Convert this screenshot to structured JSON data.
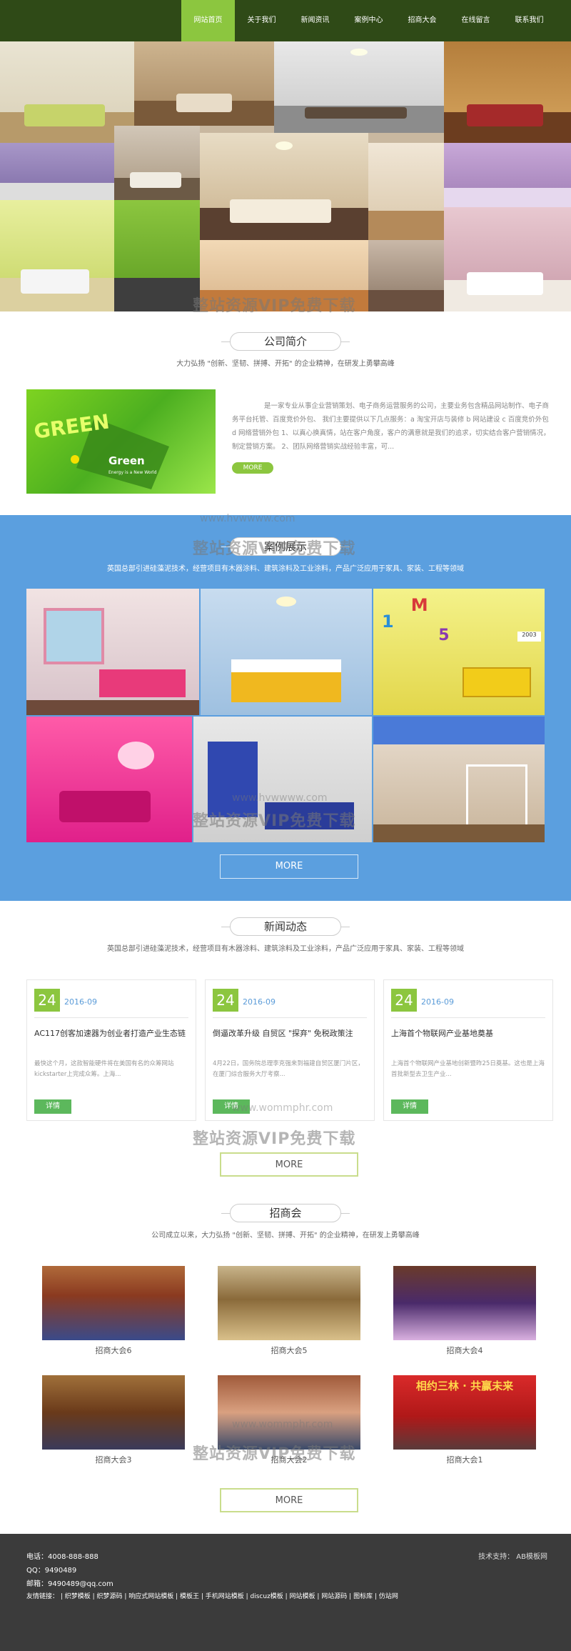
{
  "nav": {
    "items": [
      "网站首页",
      "关于我们",
      "新闻资讯",
      "案例中心",
      "招商大会",
      "在线留言",
      "联系我们"
    ]
  },
  "watermark": {
    "text": "整站资源VIP免费下载",
    "url1": "www.hvwwww.com",
    "url2": "www.wommphr.com"
  },
  "about": {
    "title": "公司简介",
    "subtitle": "大力弘扬 \"创新、坚韧、拼搏、开拓\" 的企业精神，在研发上勇攀高峰",
    "image_text_1": "GREEN",
    "image_text_2": "Green",
    "image_text_3": "Energy is a New World",
    "body": "是一家专业从事企业营销策划、电子商务运营服务的公司，主要业务包含精品网站制作、电子商务平台托管、百度竞价外包、 我们主要提供以下几点服务：a 淘宝开店与装修 b 网站建设 c 百度竞价外包 d 网络营销外包 1、以真心换真情，站在客户角度，客户的满意就是我们的追求，切实结合客户营销情况，制定营销方案。 2、团队网络营销实战经验丰富，可...",
    "more": "MORE"
  },
  "cases": {
    "title": "案例展示",
    "subtitle": "英国总部引进硅藻泥技术，经营项目有木器涂料、建筑涂料及工业涂料，产品广泛应用于家具、家装、工程等领域",
    "more": "MORE",
    "tile_text": "2003"
  },
  "news": {
    "title": "新闻动态",
    "subtitle": "英国总部引进硅藻泥技术，经营项目有木器涂料、建筑涂料及工业涂料，产品广泛应用于家具、家装、工程等领域",
    "more": "MORE",
    "items": [
      {
        "day": "24",
        "month": "2016-09",
        "title": "AC117创客加速器为创业者打造产业生态链",
        "desc": "最快这个月，这款智能硬件将在美国有名的众筹网站kickstarter上完成众筹。上海...",
        "btn": "详情"
      },
      {
        "day": "24",
        "month": "2016-09",
        "title": "倒逼改革升级 自贸区 \"探弃\" 免税政策注",
        "desc": "4月22日，国务院总理李克强来到福建自贸区厦门片区，在厦门综合服务大厅考察...",
        "btn": "详情"
      },
      {
        "day": "24",
        "month": "2016-09",
        "title": "上海首个物联网产业基地奠基",
        "desc": "上海首个物联网产业基地创新暨昨25日奠基。这也是上海首批新型去卫生产业...",
        "btn": "详情"
      }
    ]
  },
  "invest": {
    "title": "招商会",
    "subtitle": "公司成立以来，大力弘扬 \"创新、坚韧、拼搏、开拓\" 的企业精神，在研发上勇攀高峰",
    "more": "MORE",
    "banner_text": "相约三林 · 共赢未来",
    "items": [
      "招商大会6",
      "招商大会5",
      "招商大会4",
      "招商大会3",
      "招商大会2",
      "招商大会1"
    ]
  },
  "footer": {
    "phone": "电话：4008-888-888",
    "qq": "QQ：9490489",
    "email": "邮箱：9490489@qq.com",
    "links": "友情链接： | 织梦模板 | 织梦源码 | 响应式网站模板 | 模板王 | 手机网站模板 | discuz模板 | 网站模板 | 网站源码 | 图标库 | 仿站网",
    "support": "技术支持：  AB模板网"
  }
}
